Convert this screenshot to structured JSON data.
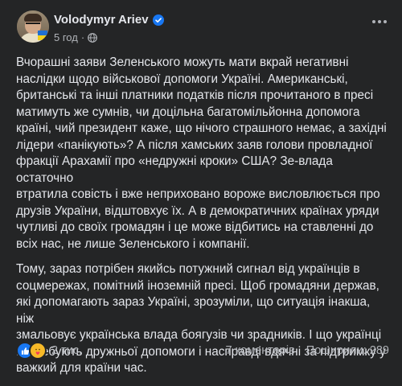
{
  "author": {
    "name": "Volodymyr Ariev",
    "time": "5 год",
    "dot": "·"
  },
  "post": {
    "paragraphs": [
      "Вчорашні заяви Зеленського можуть мати вкрай негативні\nнаслідки щодо військової допомоги Україні. Американські,\nбританські та інші платники податків після прочитаного в пресі\nматимуть же сумнів, чи доцільна багатомільйонна допомога\nкраїні, чий президент каже, що нічого страшного немає, а західні\nлідери «панікують»? А після хамських заяв голови провладної\nфракції Арахамії про «недружні кроки» США? Зе-влада остаточно\nвтратила совість і вже неприховано вороже висловлюється про\nдрузів України, відштовхує їх. А в демократичних країнах уряди\nчутливі до своїх громадян і це може відбитись на ставленні до\nвсіх нас, не лише Зеленського і компанії.",
      "Тому, зараз потрібен якийсь потужний сигнал від українців в\nсоцмережах, помітний іноземній пресі. Щоб громадяни держав,\nякі допомагають зараз Україні, зрозуміли, що ситуація інакша, ніж\nзмальовує українська влада боягузів чи зрадників. І що українці\nпотребують дружньої допомоги і насправді вдячні за підтримку у\nважкий для країни час."
    ]
  },
  "footer": {
    "reactions": "2 тис.",
    "comments": "7 коментарів",
    "shares": "Поширили: 289"
  },
  "colors": {
    "background": "#242526",
    "text": "#e4e6eb",
    "muted": "#b0b3b8",
    "accent": "#1877f2"
  },
  "icons": {
    "verified": "verified-badge-icon",
    "privacy": "globe-icon",
    "more": "more-options-icon",
    "like": "like-reaction-icon",
    "care": "care-reaction-icon"
  }
}
